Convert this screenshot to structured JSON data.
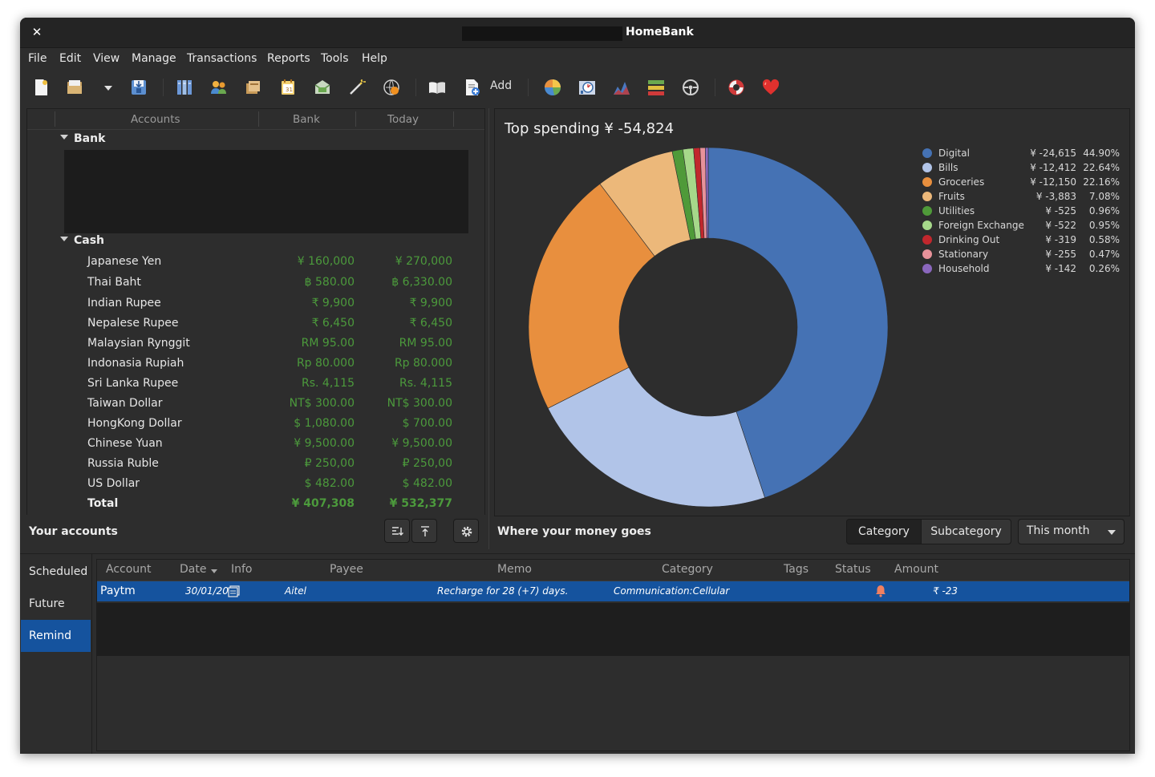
{
  "window": {
    "title": "HomeBank",
    "close_icon": "✕"
  },
  "menu": [
    "File",
    "Edit",
    "View",
    "Manage",
    "Transactions",
    "Reports",
    "Tools",
    "Help"
  ],
  "toolbar": {
    "add_label": "Add"
  },
  "accounts": {
    "headers": {
      "accounts": "Accounts",
      "bank": "Bank",
      "today": "Today"
    },
    "group_bank": "Bank",
    "group_cash": "Cash",
    "rows": [
      {
        "name": "Japanese Yen",
        "bank": "¥ 160,000",
        "today": "¥ 270,000"
      },
      {
        "name": "Thai Baht",
        "bank": "฿ 580.00",
        "today": "฿ 6,330.00"
      },
      {
        "name": "Indian Rupee",
        "bank": "₹ 9,900",
        "today": "₹ 9,900"
      },
      {
        "name": "Nepalese Rupee",
        "bank": "₹ 6,450",
        "today": "₹ 6,450"
      },
      {
        "name": "Malaysian Rynggit",
        "bank": "RM 95.00",
        "today": "RM 95.00"
      },
      {
        "name": "Indonasia Rupiah",
        "bank": "Rp 80.000",
        "today": "Rp 80.000"
      },
      {
        "name": "Sri Lanka Rupee",
        "bank": "Rs. 4,115",
        "today": "Rs. 4,115"
      },
      {
        "name": "Taiwan Dollar",
        "bank": "NT$ 300.00",
        "today": "NT$ 300.00"
      },
      {
        "name": "HongKong Dollar",
        "bank": "$ 1,080.00",
        "today": "$ 700.00"
      },
      {
        "name": "Chinese Yuan",
        "bank": "¥ 9,500.00",
        "today": "¥ 9,500.00"
      },
      {
        "name": "Russia Ruble",
        "bank": "₽ 250,00",
        "today": "₽ 250,00"
      },
      {
        "name": "US Dollar",
        "bank": "$ 482.00",
        "today": "$ 482.00"
      }
    ],
    "total": {
      "name": "Total",
      "bank": "¥ 407,308",
      "today": "¥ 532,377"
    },
    "footer_label": "Your accounts"
  },
  "spending": {
    "title": "Top spending ¥ -54,824",
    "footer_label": "Where your money goes",
    "segments": [
      "Category",
      "Subcategory"
    ],
    "active_segment": "Category",
    "period": "This month"
  },
  "chart_data": {
    "type": "pie",
    "title": "Top spending ¥ -54,824",
    "donut": true,
    "legend_position": "right",
    "slices": [
      {
        "label": "Digital",
        "amount": "¥ -24,615",
        "value": 44.9,
        "pct": "44.90%",
        "color": "#4572b4"
      },
      {
        "label": "Bills",
        "amount": "¥ -12,412",
        "value": 22.64,
        "pct": "22.64%",
        "color": "#b1c4e8"
      },
      {
        "label": "Groceries",
        "amount": "¥ -12,150",
        "value": 22.16,
        "pct": "22.16%",
        "color": "#e88f3e"
      },
      {
        "label": "Fruits",
        "amount": "¥ -3,883",
        "value": 7.08,
        "pct": "7.08%",
        "color": "#ecb87a"
      },
      {
        "label": "Utilities",
        "amount": "¥ -525",
        "value": 0.96,
        "pct": "0.96%",
        "color": "#4f9a39"
      },
      {
        "label": "Foreign Exchange",
        "amount": "¥ -522",
        "value": 0.95,
        "pct": "0.95%",
        "color": "#a6d88a"
      },
      {
        "label": "Drinking Out",
        "amount": "¥ -319",
        "value": 0.58,
        "pct": "0.58%",
        "color": "#c1272d"
      },
      {
        "label": "Stationary",
        "amount": "¥ -255",
        "value": 0.47,
        "pct": "0.47%",
        "color": "#e8929a"
      },
      {
        "label": "Household",
        "amount": "¥ -142",
        "value": 0.26,
        "pct": "0.26%",
        "color": "#8a67bd"
      }
    ]
  },
  "bottom": {
    "tabs": [
      "Scheduled",
      "Future",
      "Remind"
    ],
    "active_tab": "Remind",
    "columns": [
      "Account",
      "Date",
      "Info",
      "Payee",
      "Memo",
      "Category",
      "Tags",
      "Status",
      "Amount"
    ],
    "row": {
      "account": "Paytm",
      "date": "30/01/20",
      "payee": "Aitel",
      "memo": "Recharge for 28 (+7) days.",
      "category": "Communication:Cellular",
      "amount": "₹ -23"
    }
  }
}
